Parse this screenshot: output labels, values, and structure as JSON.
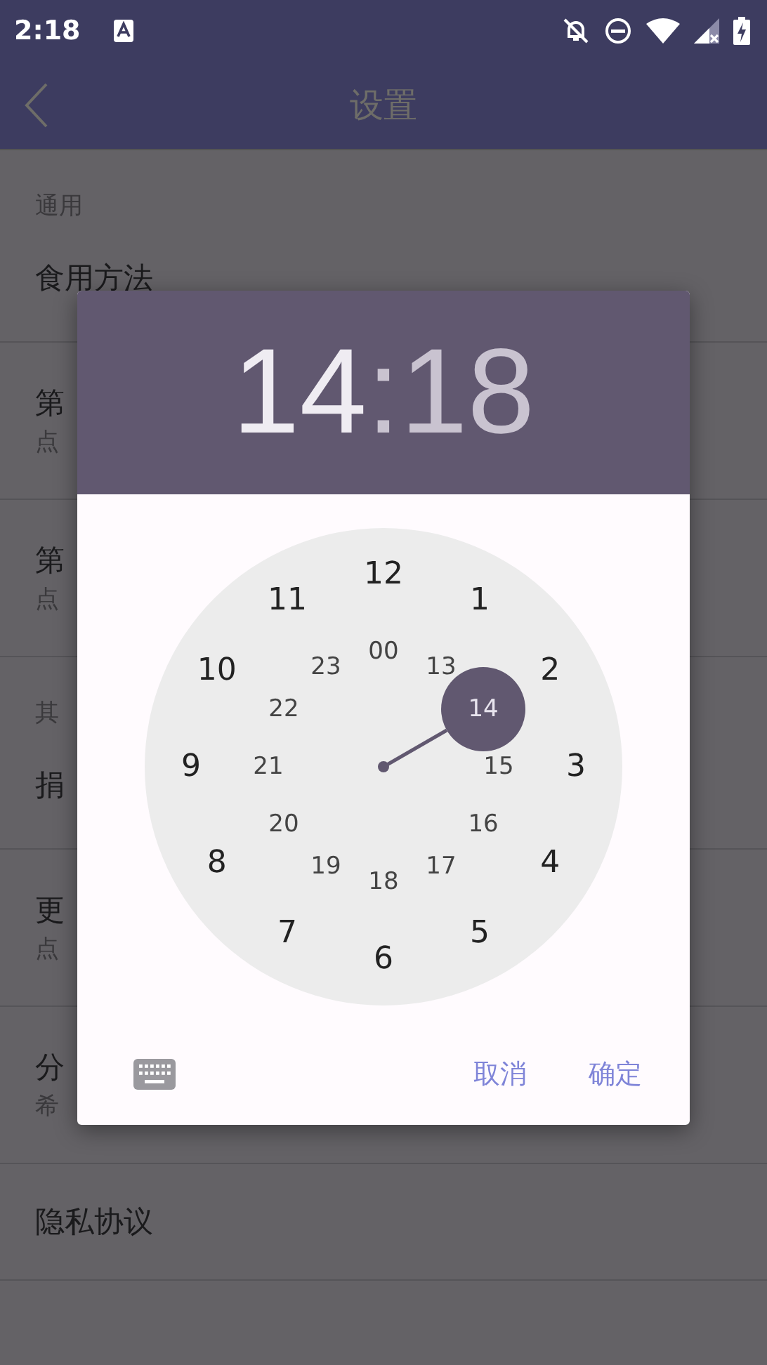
{
  "status_bar": {
    "time": "2:18"
  },
  "app_bar": {
    "title": "设置"
  },
  "sections": [
    {
      "header": "通用",
      "items": [
        {
          "title": "食用方法"
        },
        {
          "title": "第",
          "subtitle": "点"
        },
        {
          "title": "第",
          "subtitle": "点"
        }
      ]
    },
    {
      "header": "其",
      "items": [
        {
          "title": "捐"
        },
        {
          "title": "更",
          "subtitle": "点"
        },
        {
          "title": "分",
          "subtitle": "希"
        },
        {
          "title": "隐私协议"
        }
      ]
    }
  ],
  "time_picker": {
    "hour": {
      "text": "14",
      "selected": true
    },
    "separator": ":",
    "minute": {
      "text": "18",
      "selected": false
    },
    "outer": [
      {
        "label": "12",
        "selected": false
      },
      {
        "label": "1",
        "selected": false
      },
      {
        "label": "2",
        "selected": false
      },
      {
        "label": "3",
        "selected": false
      },
      {
        "label": "4",
        "selected": false
      },
      {
        "label": "5",
        "selected": false
      },
      {
        "label": "6",
        "selected": false
      },
      {
        "label": "7",
        "selected": false
      },
      {
        "label": "8",
        "selected": false
      },
      {
        "label": "9",
        "selected": false
      },
      {
        "label": "10",
        "selected": false
      },
      {
        "label": "11",
        "selected": false
      }
    ],
    "inner": [
      {
        "label": "00",
        "selected": false
      },
      {
        "label": "13",
        "selected": false
      },
      {
        "label": "14",
        "selected": true
      },
      {
        "label": "15",
        "selected": false
      },
      {
        "label": "16",
        "selected": false
      },
      {
        "label": "17",
        "selected": false
      },
      {
        "label": "18",
        "selected": false
      },
      {
        "label": "19",
        "selected": false
      },
      {
        "label": "20",
        "selected": false
      },
      {
        "label": "21",
        "selected": false
      },
      {
        "label": "22",
        "selected": false
      },
      {
        "label": "23",
        "selected": false
      }
    ],
    "buttons": [
      "取消",
      "确定"
    ]
  }
}
